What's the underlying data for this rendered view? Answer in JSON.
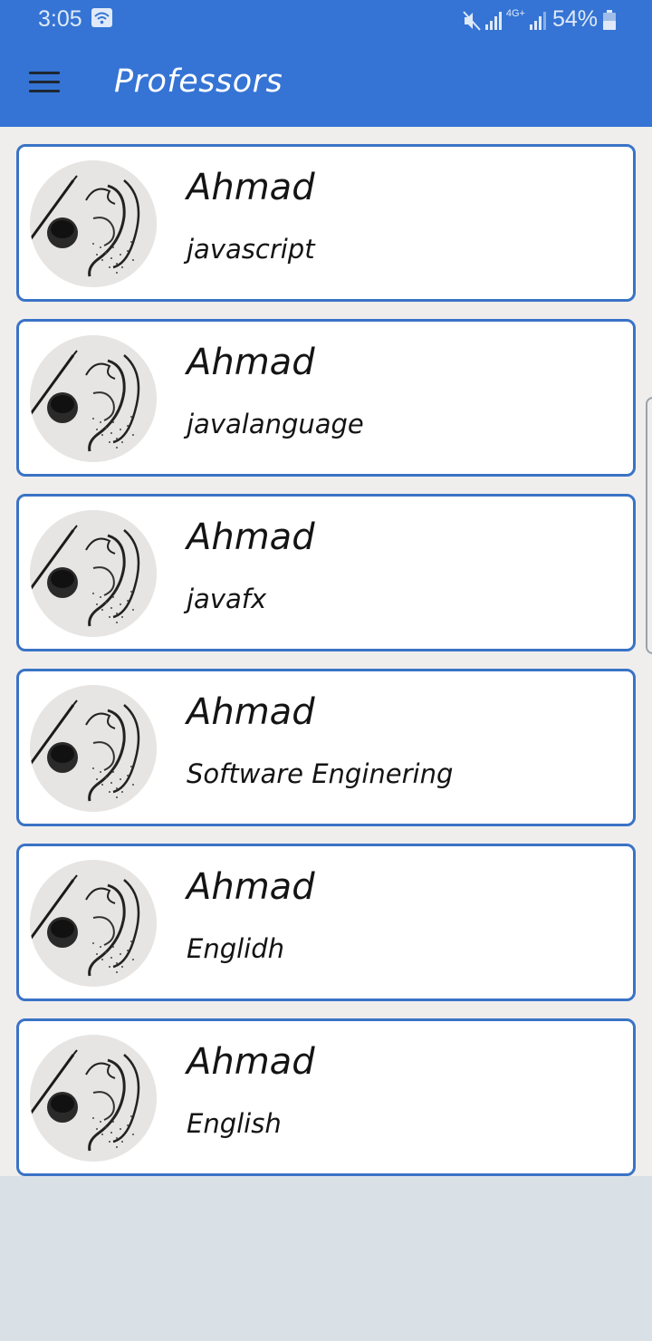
{
  "status_bar": {
    "time": "3:05",
    "network_label": "4G+",
    "battery": "54%",
    "icons": [
      "wifi-icon",
      "mute-icon",
      "signal-icon",
      "battery-icon"
    ]
  },
  "app_bar": {
    "title": "Professors",
    "menu_icon": "hamburger-menu-icon",
    "color": "#3574d4"
  },
  "professors": [
    {
      "name": "Ahmad",
      "subject": "javascript"
    },
    {
      "name": "Ahmad",
      "subject": "javalanguage"
    },
    {
      "name": "Ahmad",
      "subject": "javafx"
    },
    {
      "name": "Ahmad",
      "subject": "Software Enginering"
    },
    {
      "name": "Ahmad",
      "subject": "Englidh"
    },
    {
      "name": "Ahmad",
      "subject": "English"
    }
  ],
  "colors": {
    "accent": "#3574d4",
    "card_border": "#3a73c6",
    "list_background": "#efeeed",
    "page_background": "#d9e1e7"
  }
}
